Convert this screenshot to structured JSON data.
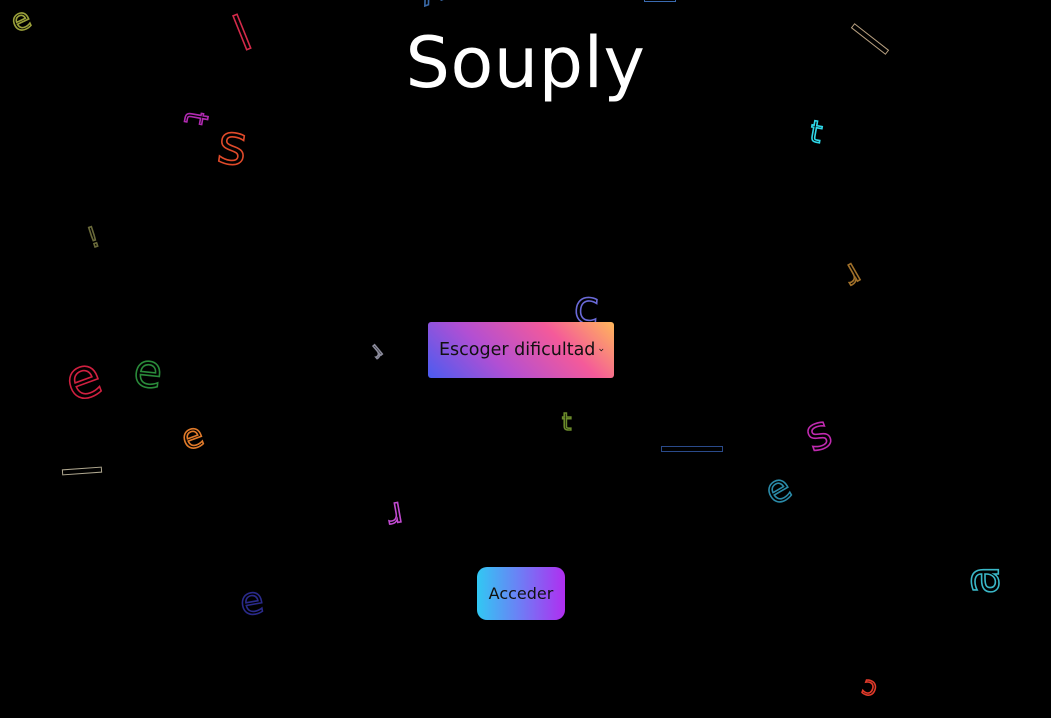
{
  "title": "Souply",
  "difficulty_select": {
    "selected_label": "Escoger dificultad"
  },
  "access_button": {
    "label": "Acceder"
  },
  "background_letters": [
    {
      "char": "e",
      "color": "#9aa03a"
    },
    {
      "char": "l",
      "color": "#d42a4a"
    },
    {
      "char": "t",
      "color": "#b02ab0"
    },
    {
      "char": "s",
      "color": "#e04a2a"
    },
    {
      "char": "t",
      "color": "#2fd7e8"
    },
    {
      "char": "!",
      "color": "#6a6a3a"
    },
    {
      "char": "r",
      "color": "#a0702a"
    },
    {
      "char": "c",
      "color": "#6a6ad8"
    },
    {
      "char": "r",
      "color": "#8a8a9a"
    },
    {
      "char": "e",
      "color": "#d02040"
    },
    {
      "char": "e",
      "color": "#2a8a3a"
    },
    {
      "char": "e",
      "color": "#e07a2a"
    },
    {
      "char": "t",
      "color": "#6a8a2a"
    },
    {
      "char": "s",
      "color": "#c02ab0"
    },
    {
      "char": "e",
      "color": "#2a8aa8"
    },
    {
      "char": "r",
      "color": "#c04ad0"
    },
    {
      "char": "e",
      "color": "#2a2a8a"
    },
    {
      "char": "a",
      "color": "#3ab8c8"
    },
    {
      "char": "c",
      "color": "#e03a2a"
    },
    {
      "char": "y",
      "color": "#3a6aa8"
    }
  ]
}
